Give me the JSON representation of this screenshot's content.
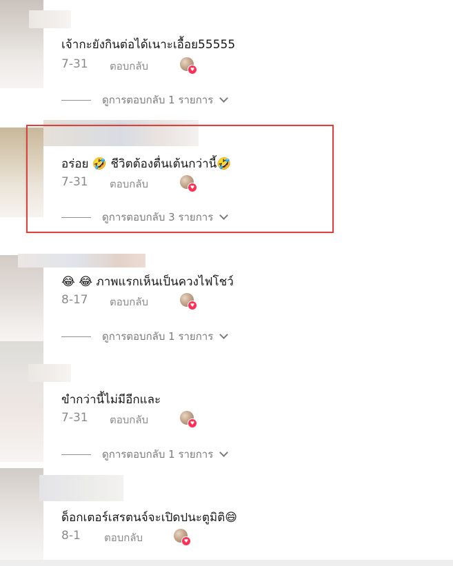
{
  "comments": [
    {
      "text": "เจ้ากะยังกินต่อได้เนาะเอื้อย55555",
      "date": "7-31",
      "reply_label": "ตอบกลับ",
      "view_replies": "ดูการตอบกลับ 1 รายการ"
    },
    {
      "text": "อร่อย 🤣 ชีวิตต้องตื่นเต้นกว่านี้🤣",
      "date": "7-31",
      "reply_label": "ตอบกลับ",
      "view_replies": "ดูการตอบกลับ 3 รายการ"
    },
    {
      "text": "😂 😂 ภาพแรกเห็นเป็นควงไฟโชว์",
      "date": "8-17",
      "reply_label": "ตอบกลับ",
      "view_replies": "ดูการตอบกลับ 1 รายการ"
    },
    {
      "text": "ขำกว่านี้ไม่มีอีกและ",
      "date": "7-31",
      "reply_label": "ตอบกลับ",
      "view_replies": "ดูการตอบกลับ 1 รายการ"
    },
    {
      "text": "ด็อกเตอร์เสรตนจ์จะเปิดปนะตูมิติ😄",
      "date": "8-1",
      "reply_label": "ตอบกลับ"
    }
  ],
  "icons": {
    "chevron": "chevron-down-icon",
    "liked_by_author": "author-liked-heart-icon"
  },
  "colors": {
    "highlight": "#d9413d",
    "like_heart": "#ff2f56",
    "meta_text": "#8a8a8a"
  }
}
